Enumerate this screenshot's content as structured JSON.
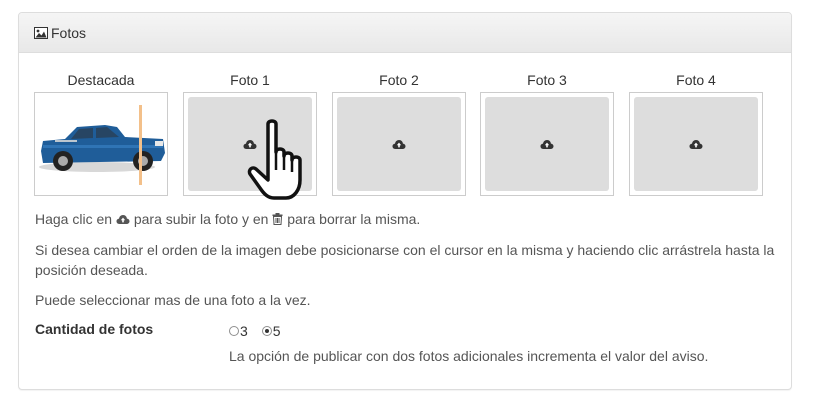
{
  "panel": {
    "title": "Fotos",
    "title_icon": "image-icon"
  },
  "photos": [
    {
      "label": "Destacada",
      "state": "filled",
      "content": "blue-pickup-truck-photo"
    },
    {
      "label": "Foto 1",
      "state": "empty",
      "icon": "cloud-upload-icon"
    },
    {
      "label": "Foto 2",
      "state": "empty",
      "icon": "cloud-upload-icon"
    },
    {
      "label": "Foto 3",
      "state": "empty",
      "icon": "cloud-upload-icon"
    },
    {
      "label": "Foto 4",
      "state": "empty",
      "icon": "cloud-upload-icon"
    }
  ],
  "help": {
    "line1_part1": "Haga clic en",
    "line1_part2": "para subir la foto y en",
    "line1_part3": "para borrar la misma.",
    "line2": "Si desea cambiar el orden de la imagen debe posicionarse con el cursor en la misma y haciendo clic arrástrela hasta la posición deseada.",
    "line3": "Puede seleccionar mas de una foto a la vez."
  },
  "quantity": {
    "label": "Cantidad de fotos",
    "options": [
      "3",
      "5"
    ],
    "selected": "5",
    "note": "La opción de publicar con dos fotos adicionales incrementa el valor del aviso."
  },
  "cursor": "hand-pointer-icon",
  "colors": {
    "slot_bg": "#dddddd",
    "truck_blue": "#1f5d99",
    "heading_bg": "#f0f0f0"
  }
}
